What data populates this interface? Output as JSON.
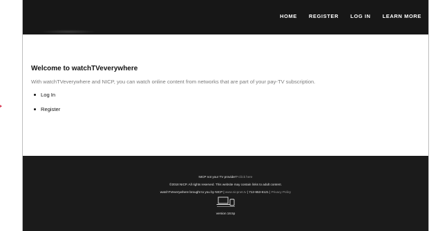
{
  "nav": {
    "items": [
      "HOME",
      "REGISTER",
      "LOG IN",
      "LEARN MORE"
    ]
  },
  "main": {
    "title": "Welcome to watchTVeverywhere",
    "intro": "With watchTVeverywhere and NICP, you can watch online content from networks that are part of your pay-TV subscription.",
    "links": [
      "Log In",
      "Register"
    ]
  },
  "footer": {
    "provider_text": "NICP not your TV provider?",
    "provider_link": "Click here",
    "copyright": "©2018 NICP. All rights reserved. This website may contain links to adult content.",
    "brought_by": "watchTVeverywhere brought to you by NICP",
    "sep": " | ",
    "website": "www.nicpnet.tv",
    "phone": "712-653-6121",
    "privacy": "Privacy Policy",
    "devices_icon": "devices-icon",
    "version": "version 18.5p"
  },
  "colors": {
    "header_bg": "#171717",
    "footer_bg": "#1b1b1b",
    "marker": "#d9405a"
  }
}
